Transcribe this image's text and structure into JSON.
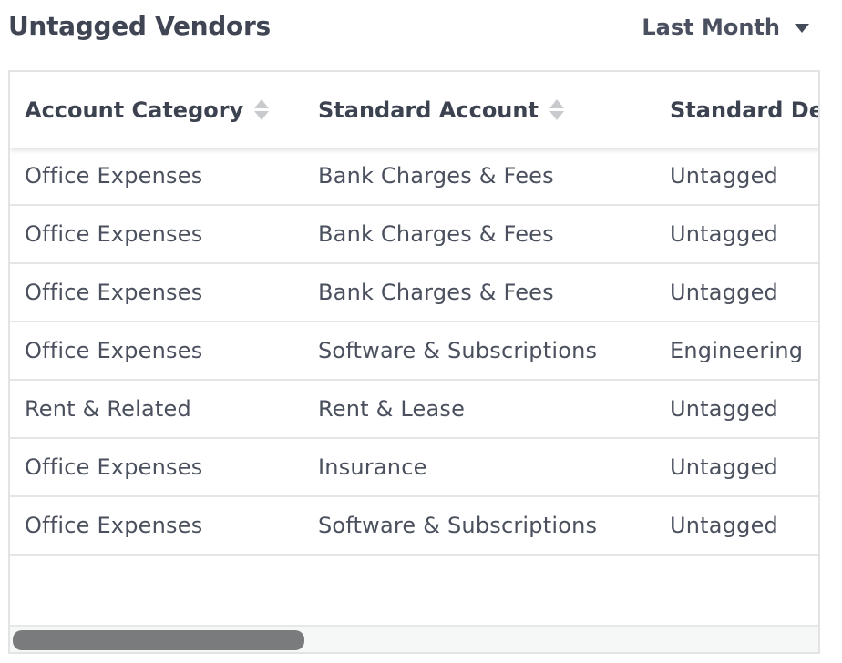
{
  "header": {
    "title": "Untagged Vendors",
    "period_selector": {
      "selected": "Last Month",
      "icon": "caret-down-icon"
    }
  },
  "table": {
    "columns": [
      {
        "label": "Account Category",
        "sortable": true
      },
      {
        "label": "Standard Account",
        "sortable": true
      },
      {
        "label": "Standard Department",
        "sortable": false
      }
    ],
    "rows": [
      [
        "Office Expenses",
        "Bank Charges & Fees",
        "Untagged"
      ],
      [
        "Office Expenses",
        "Bank Charges & Fees",
        "Untagged"
      ],
      [
        "Office Expenses",
        "Bank Charges & Fees",
        "Untagged"
      ],
      [
        "Office Expenses",
        "Software & Subscriptions",
        "Engineering"
      ],
      [
        "Rent & Related",
        "Rent & Lease",
        "Untagged"
      ],
      [
        "Office Expenses",
        "Insurance",
        "Untagged"
      ],
      [
        "Office Expenses",
        "Software & Subscriptions",
        "Untagged"
      ]
    ]
  },
  "colors": {
    "text": "#3c4250",
    "border": "#e2e3e5",
    "scroll_thumb": "#7a7b7d",
    "sort_icon": "#c9cacd"
  }
}
